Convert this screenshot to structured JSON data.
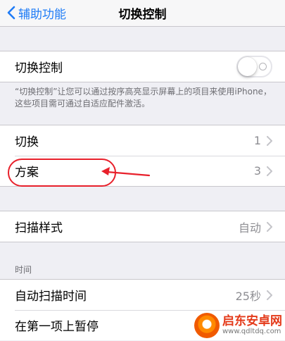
{
  "nav": {
    "back_label": "辅助功能",
    "title": "切换控制"
  },
  "switch_control": {
    "label": "切换控制",
    "enabled": false
  },
  "description": "“切换控制”让您可以通过按序高亮显示屏幕上的项目来使用iPhone，这些项目需可通过自适应配件激活。",
  "switches": {
    "label": "切换",
    "value": "1"
  },
  "recipes": {
    "label": "方案",
    "value": "3"
  },
  "scan_style": {
    "label": "扫描样式",
    "value": "自动"
  },
  "timing_header": "时间",
  "auto_scan_time": {
    "label": "自动扫描时间",
    "value": "25秒"
  },
  "pause_first": {
    "label": "在第一项上暂停"
  },
  "annotation_color": "#e8202b",
  "watermark": {
    "title": "启东安卓网",
    "url": "www.qdltdq.com"
  }
}
